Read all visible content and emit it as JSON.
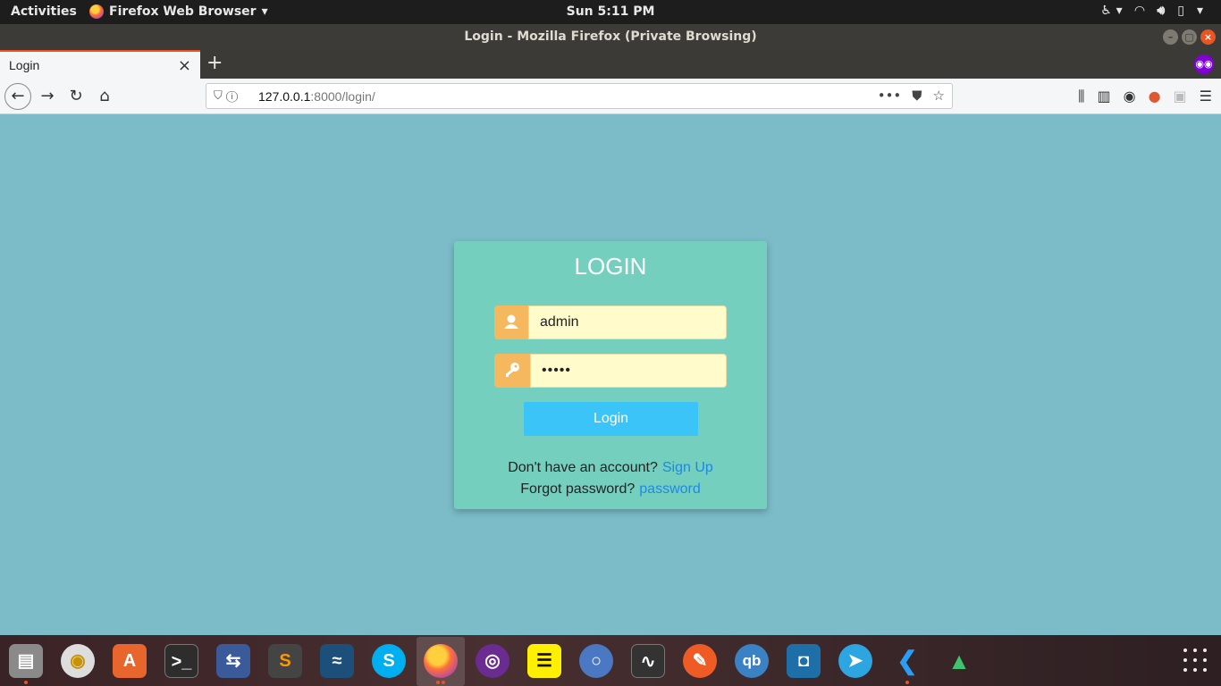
{
  "topbar": {
    "activities": "Activities",
    "app_menu": "Firefox Web Browser",
    "clock": "Sun  5:11 PM"
  },
  "window": {
    "title": "Login - Mozilla Firefox (Private Browsing)"
  },
  "tabs": [
    {
      "label": "Login"
    }
  ],
  "urlbar": {
    "host": "127.0.0.1",
    "rest": ":8000/login/"
  },
  "login": {
    "heading": "LOGIN",
    "username_value": "admin",
    "password_mask": "•••••",
    "button_label": "Login",
    "signup_prompt": "Don't have an account?",
    "signup_link": "Sign Up",
    "forgot_prompt": "Forgot password?",
    "forgot_link": "password"
  },
  "colors": {
    "page_bg": "#7bbcc8",
    "card_bg": "#74cfbf",
    "icon_bg": "#f5b85e",
    "input_bg": "#fffbcb",
    "button_bg": "#3bc4f7",
    "link": "#1e88e5"
  },
  "dock": {
    "icons": [
      "files-icon",
      "rhythmbox-icon",
      "software-icon",
      "terminal-icon",
      "remmina-icon",
      "sublime-icon",
      "mysql-workbench-icon",
      "skype-icon",
      "firefox-icon",
      "tor-icon",
      "notes-icon",
      "chromium-icon",
      "system-monitor-icon",
      "postman-icon",
      "qbittorrent-icon",
      "ubuntu-software-box-icon",
      "telegram-icon",
      "vscode-icon",
      "rocket-icon"
    ]
  }
}
